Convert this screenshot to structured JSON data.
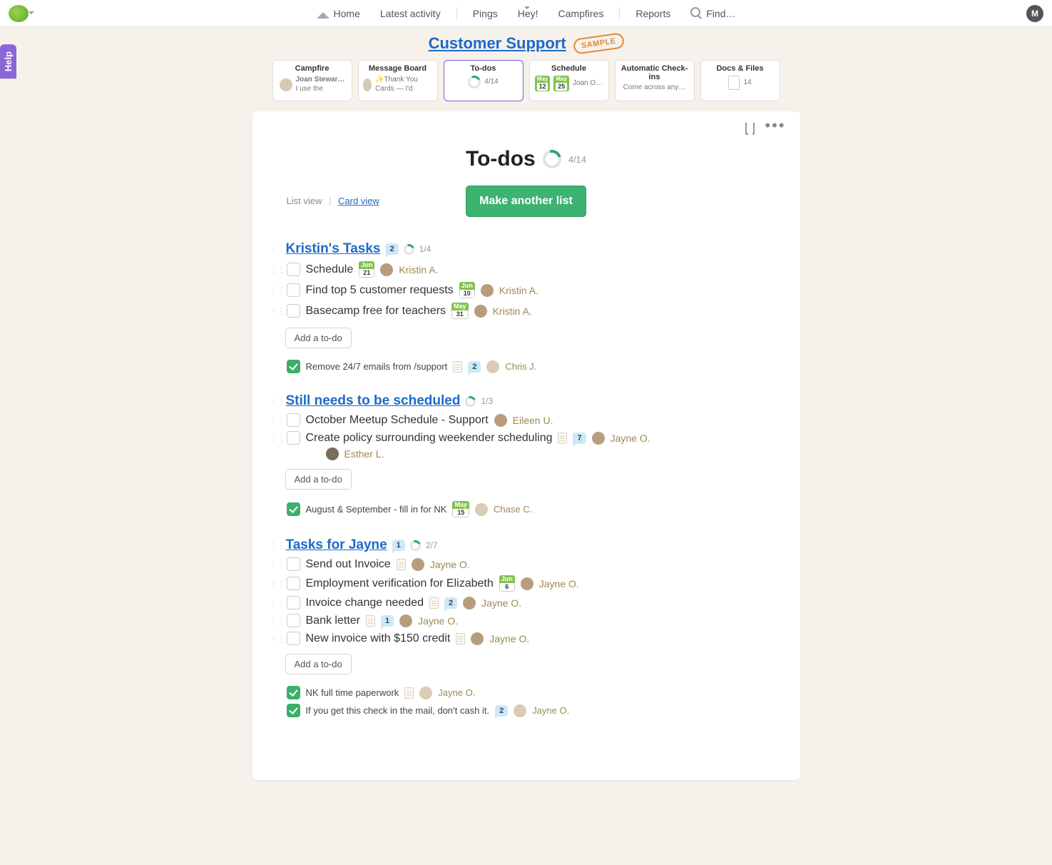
{
  "nav": {
    "home": "Home",
    "activity": "Latest activity",
    "pings": "Pings",
    "hey": "Hey!",
    "campfires": "Campfires",
    "reports": "Reports",
    "find": "Find…",
    "avatar_initial": "M"
  },
  "help_tab": "Help",
  "project": {
    "title": "Customer Support",
    "sample": "SAMPLE"
  },
  "tools": {
    "campfire": {
      "title": "Campfire",
      "sub_name": "Joan Stewar…",
      "sub_text": "I use the"
    },
    "message_board": {
      "title": "Message Board",
      "sub": "✨Thank You Cards — I'd"
    },
    "todos": {
      "title": "To-dos",
      "count": "4/14"
    },
    "schedule": {
      "title": "Schedule",
      "d1m": "May",
      "d1d": "12",
      "d2m": "May",
      "d2d": "25",
      "name": "Joan O…"
    },
    "checkins": {
      "title": "Automatic Check-ins",
      "sub": "Come across any…"
    },
    "docs": {
      "title": "Docs & Files",
      "count": "14"
    }
  },
  "page": {
    "title": "To-dos",
    "count": "4/14",
    "list_view": "List view",
    "card_view": "Card view",
    "make_list": "Make another list"
  },
  "add_label": "Add a to-do",
  "lists": [
    {
      "title": "Kristin's Tasks",
      "comments": "2",
      "progress": "1/4",
      "items": [
        {
          "text": "Schedule",
          "date_m": "Jun",
          "date_d": "21",
          "assignee": "Kristin A."
        },
        {
          "text": "Find top 5 customer requests",
          "date_m": "Jun",
          "date_d": "10",
          "assignee": "Kristin A."
        },
        {
          "text": "Basecamp free for teachers",
          "date_m": "May",
          "date_d": "31",
          "assignee": "Kristin A."
        }
      ],
      "done": [
        {
          "text": "Remove 24/7 emails from /support",
          "comments": "2",
          "assignee": "Chris J.",
          "has_doc": true
        }
      ]
    },
    {
      "title": "Still needs to be scheduled",
      "progress": "1/3",
      "items": [
        {
          "text": "October Meetup Schedule - Support",
          "assignee": "Eileen U."
        },
        {
          "text": "Create policy surrounding weekender scheduling",
          "comments": "7",
          "assignee": "Jayne O.",
          "has_doc": true,
          "extra_assignee": "Esther L."
        }
      ],
      "done": [
        {
          "text": "August & September - fill in for NK",
          "date_m": "May",
          "date_d": "15",
          "assignee": "Chase C."
        }
      ]
    },
    {
      "title": "Tasks for Jayne",
      "comments": "1",
      "progress": "2/7",
      "items": [
        {
          "text": "Send out Invoice",
          "assignee": "Jayne O.",
          "has_doc": true
        },
        {
          "text": "Employment verification for Elizabeth",
          "date_m": "Jun",
          "date_d": "6",
          "assignee": "Jayne O."
        },
        {
          "text": "Invoice change needed",
          "comments": "2",
          "assignee": "Jayne O.",
          "has_doc": true
        },
        {
          "text": "Bank letter",
          "comments": "1",
          "assignee": "Jayne O.",
          "has_doc": true
        },
        {
          "text": "New invoice with $150 credit",
          "assignee": "Jayne O.",
          "has_doc": true
        }
      ],
      "done": [
        {
          "text": "NK full time paperwork",
          "assignee": "Jayne O.",
          "has_doc": true
        },
        {
          "text": "If you get this check in the mail, don't cash it.",
          "comments": "2",
          "assignee": "Jayne O."
        }
      ]
    }
  ]
}
